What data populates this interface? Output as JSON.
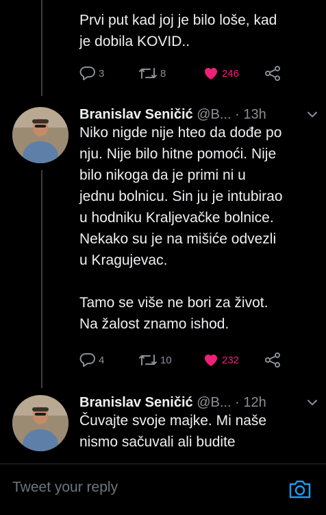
{
  "tweets": [
    {
      "text": "Prvi put kad joj je bilo loše, kad\nje dobila KOVID..",
      "actions": {
        "replies": "3",
        "retweets": "8",
        "likes": "246"
      }
    },
    {
      "author": "Branislav Seničić",
      "handle": "@B...",
      "separator": "·",
      "time": "13h",
      "text": "Niko nigde nije hteo da dođe po\nnju. Nije bilo hitne pomoći. Nije\nbilo nikoga da je primi ni u\njednu bolnicu. Sin ju je intubirao\nu hodniku  Kraljevačke bolnice.\nNekako su je na mišiće odvezli\nu Kragujevac.\n\nTamo se više ne bori za život.\nNa žalost znamo ishod.",
      "actions": {
        "replies": "4",
        "retweets": "10",
        "likes": "232"
      }
    },
    {
      "author": "Branislav Seničić",
      "handle": "@B...",
      "separator": "·",
      "time": "12h",
      "text": "Čuvajte svoje majke. Mi naše\nnismo sačuvali ali budite"
    }
  ],
  "reply": {
    "placeholder": "Tweet your reply"
  },
  "colors": {
    "like": "#f0207a",
    "muted": "#8b9096",
    "accent": "#1d9bf0",
    "background": "#000000"
  },
  "icons": [
    "reply-icon",
    "retweet-icon",
    "heart-icon",
    "share-icon",
    "chevron-down-icon",
    "camera-icon"
  ]
}
